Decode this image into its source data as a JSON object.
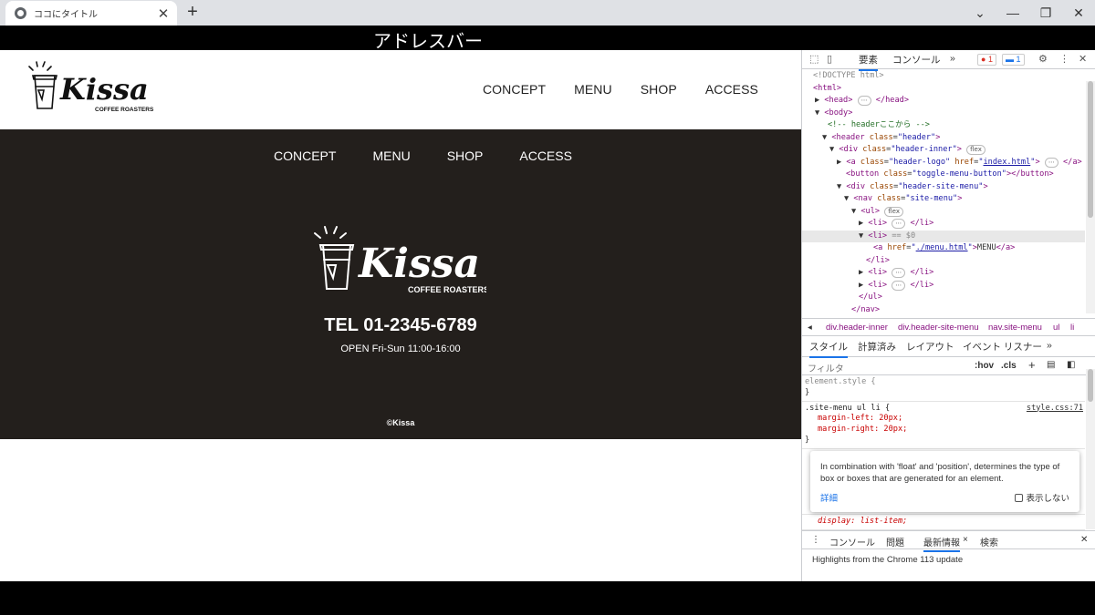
{
  "browser": {
    "tab_title": "ココにタイトル",
    "tab_close": "✕",
    "new_tab": "+",
    "address_bar": "アドレスバー"
  },
  "site": {
    "header_nav": [
      "CONCEPT",
      "MENU",
      "SHOP",
      "ACCESS"
    ],
    "menu_items": [
      "CONCEPT",
      "MENU",
      "SHOP",
      "ACCESS"
    ],
    "logo_text": "Kissa",
    "logo_sub": "COFFEE ROASTERS",
    "tel": "TEL 01-2345-6789",
    "open": "OPEN Fri-Sun 11:00-16:00",
    "copyright": "©Kissa",
    "colors": {
      "menu_bg": "#231f1c",
      "text": "#ffffff"
    }
  },
  "devtools": {
    "tabs": {
      "elements": "要素",
      "console": "コンソール",
      "more": "»"
    },
    "errors": "1",
    "messages": "1",
    "dom": {
      "doctype": "<!DOCTYPE html>",
      "comment": "<!-- headerここから -->",
      "selected_marker": "== $0",
      "href_index": "index.html",
      "href_menu": "./menu.html",
      "menu_text": "MENU",
      "flex": "flex",
      "ellipsis": "⋯"
    },
    "breadcrumbs": [
      "div.header-inner",
      "div.header-site-menu",
      "nav.site-menu",
      "ul",
      "li"
    ],
    "style_tabs": [
      "スタイル",
      "計算済み",
      "レイアウト",
      "イベント リスナー",
      "»"
    ],
    "filter_placeholder": "フィルタ",
    "hov": ":hov",
    "cls": ".cls",
    "styles": {
      "element_style": "element.style {",
      "close": "}",
      "rule_selector": ".site-menu ul li {",
      "rule_source": "style.css:71",
      "margin_left": "margin-left: 20px;",
      "margin_right": "margin-right: 20px;",
      "display_prop": "display: list-item;"
    },
    "tooltip": {
      "text": "In combination with 'float' and 'position', determines the type of box or boxes that are generated for an element.",
      "link": "詳細",
      "checkbox": "表示しない"
    },
    "drawer_tabs": [
      "コンソール",
      "問題",
      "最新情報",
      "検索"
    ],
    "drawer_close": "×",
    "drawer_content": "Highlights from the Chrome 113 update"
  }
}
